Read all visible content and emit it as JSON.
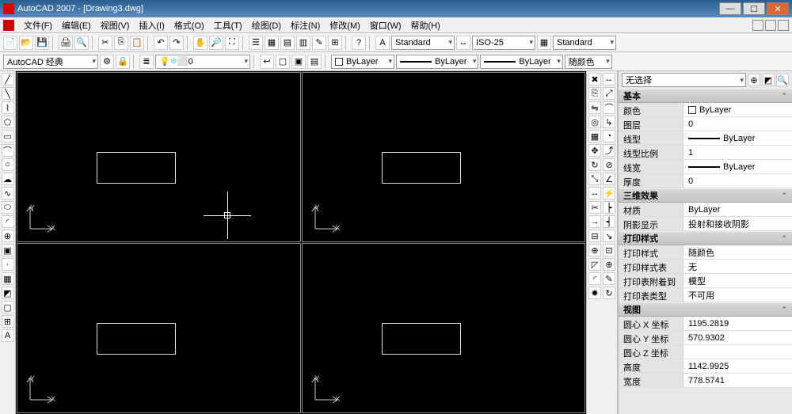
{
  "titlebar": {
    "title": "AutoCAD 2007 - [Drawing3.dwg]"
  },
  "menubar": {
    "items": [
      {
        "label": "文件(F)"
      },
      {
        "label": "编辑(E)"
      },
      {
        "label": "视图(V)"
      },
      {
        "label": "插入(I)"
      },
      {
        "label": "格式(O)"
      },
      {
        "label": "工具(T)"
      },
      {
        "label": "绘图(D)"
      },
      {
        "label": "标注(N)"
      },
      {
        "label": "修改(M)"
      },
      {
        "label": "窗口(W)"
      },
      {
        "label": "帮助(H)"
      }
    ]
  },
  "toolbar1": {
    "style_label": "Standard",
    "dim_style": "ISO-25",
    "table_style": "Standard"
  },
  "toolbar2": {
    "workspace": "AutoCAD 经典",
    "layer": "0",
    "color": "ByLayer",
    "linetype": "ByLayer",
    "lineweight": "ByLayer",
    "plotstyle": "随颜色"
  },
  "properties": {
    "selection": "无选择",
    "sections": {
      "basic": {
        "title": "基本",
        "rows": [
          {
            "k": "颜色",
            "v": "ByLayer",
            "isColor": true
          },
          {
            "k": "图层",
            "v": "0"
          },
          {
            "k": "线型",
            "v": "ByLayer",
            "isLine": true
          },
          {
            "k": "线型比例",
            "v": "1"
          },
          {
            "k": "线宽",
            "v": "ByLayer",
            "isLine": true
          },
          {
            "k": "厚度",
            "v": "0"
          }
        ]
      },
      "threed": {
        "title": "三维效果",
        "rows": [
          {
            "k": "材质",
            "v": "ByLayer"
          },
          {
            "k": "阴影显示",
            "v": "投射和接收阴影"
          }
        ]
      },
      "plot": {
        "title": "打印样式",
        "rows": [
          {
            "k": "打印样式",
            "v": "随颜色"
          },
          {
            "k": "打印样式表",
            "v": "无"
          },
          {
            "k": "打印表附着到",
            "v": "模型"
          },
          {
            "k": "打印表类型",
            "v": "不可用"
          }
        ]
      },
      "view": {
        "title": "视图",
        "rows": [
          {
            "k": "圆心 X 坐标",
            "v": "1195.2819"
          },
          {
            "k": "圆心 Y 坐标",
            "v": "570.9302"
          },
          {
            "k": "圆心 Z 坐标",
            "v": ""
          },
          {
            "k": "高度",
            "v": "1142.9925"
          },
          {
            "k": "宽度",
            "v": "778.5741"
          }
        ]
      }
    }
  },
  "axis": {
    "x": "X",
    "y": "Y"
  }
}
